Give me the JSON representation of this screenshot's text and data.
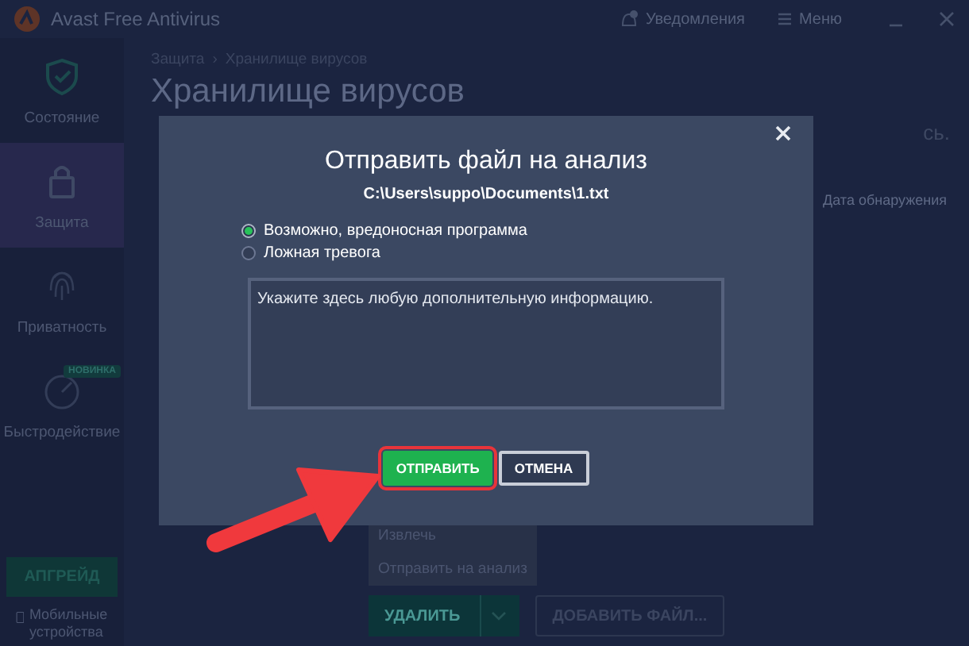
{
  "window": {
    "title": "Avast Free Antivirus",
    "notifications": "Уведомления",
    "menu": "Меню"
  },
  "sidebar": {
    "items": [
      {
        "label": "Состояние",
        "selected": false
      },
      {
        "label": "Защита",
        "selected": true
      },
      {
        "label": "Приватность",
        "selected": false
      },
      {
        "label": "Быстродействие",
        "selected": false,
        "badge": "НОВИНКА"
      }
    ],
    "upgrade": "АПГРЕЙД",
    "mobile": "Мобильные устройства"
  },
  "breadcrumbs": {
    "items": [
      "Защита",
      "Хранилище вирусов"
    ],
    "separator": "›"
  },
  "page_title": "Хранилище вирусов",
  "partial_text": "сь.",
  "table": {
    "columns": [
      "Дата обнаружения"
    ]
  },
  "context_menu": [
    "Извлечь",
    "Отправить на анализ"
  ],
  "actions": {
    "delete": "УДАЛИТЬ",
    "add_file": "ДОБАВИТЬ ФАЙЛ..."
  },
  "dialog": {
    "title": "Отправить файл на анализ",
    "path": "C:\\Users\\suppo\\Documents\\1.txt",
    "options": [
      {
        "label": "Возможно, вредоносная программа",
        "selected": true
      },
      {
        "label": "Ложная тревога",
        "selected": false
      }
    ],
    "details": {
      "placeholder": "Укажите здесь любую дополнительную информацию."
    },
    "buttons": [
      {
        "label": "ОТПРАВИТЬ",
        "kind": "primary",
        "highlighted": true
      },
      {
        "label": "ОТМЕНА",
        "kind": "secondary",
        "highlighted": false
      }
    ]
  }
}
